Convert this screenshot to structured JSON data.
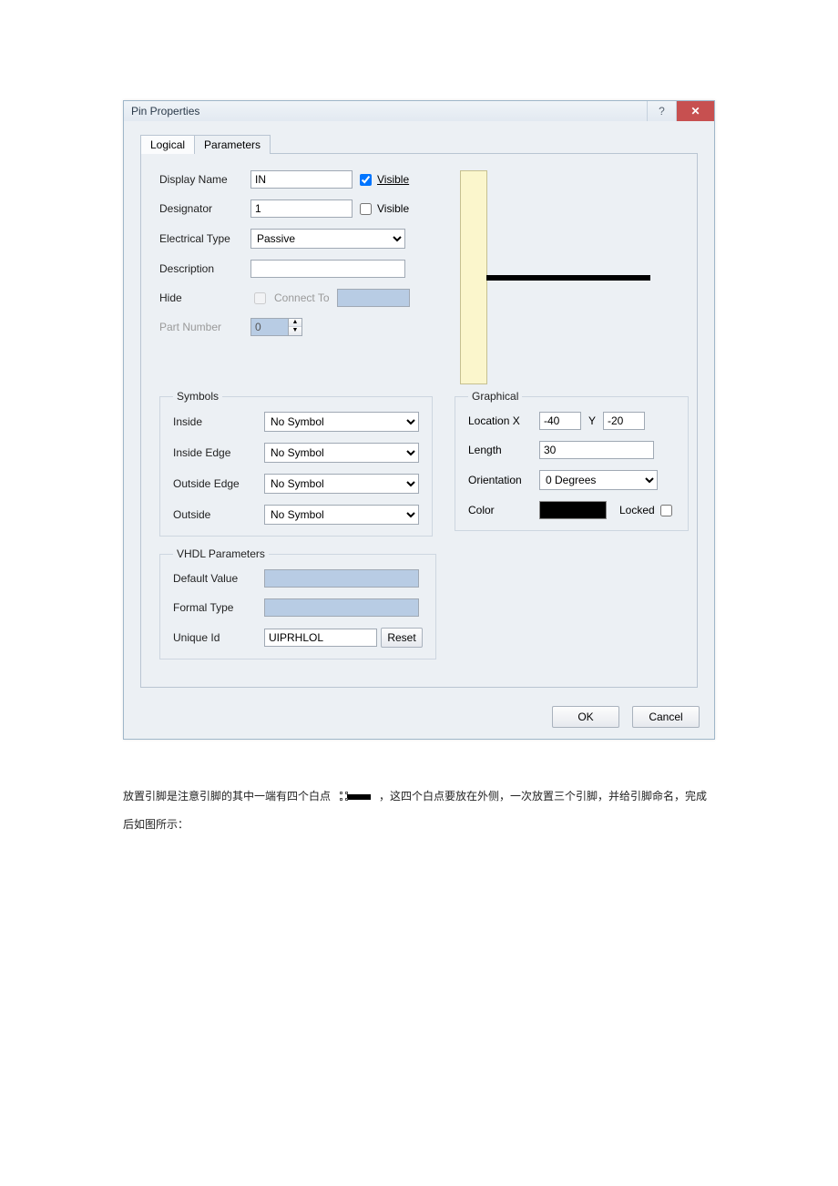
{
  "window": {
    "title": "Pin Properties"
  },
  "tabs": {
    "logical": "Logical",
    "parameters": "Parameters"
  },
  "fields": {
    "displayName": {
      "label": "Display Name",
      "value": "IN",
      "visibleLabel": "Visible",
      "visibleChecked": true
    },
    "designator": {
      "label": "Designator",
      "value": "1",
      "visibleLabel": "Visible",
      "visibleChecked": false
    },
    "electricalType": {
      "label": "Electrical Type",
      "value": "Passive"
    },
    "description": {
      "label": "Description",
      "value": ""
    },
    "hide": {
      "label": "Hide",
      "connectLabel": "Connect To",
      "checked": false
    },
    "partNumber": {
      "label": "Part Number",
      "value": "0"
    }
  },
  "symbols": {
    "legend": "Symbols",
    "inside": {
      "label": "Inside",
      "value": "No Symbol"
    },
    "insideEdge": {
      "label": "Inside Edge",
      "value": "No Symbol"
    },
    "outsideEdge": {
      "label": "Outside Edge",
      "value": "No Symbol"
    },
    "outside": {
      "label": "Outside",
      "value": "No Symbol"
    }
  },
  "vhdl": {
    "legend": "VHDL Parameters",
    "defaultValue": {
      "label": "Default Value",
      "value": ""
    },
    "formalType": {
      "label": "Formal Type",
      "value": ""
    },
    "uniqueId": {
      "label": "Unique Id",
      "value": "UIPRHLOL",
      "reset": "Reset"
    }
  },
  "graphical": {
    "legend": "Graphical",
    "locationX": {
      "label": "Location X",
      "value": "-40"
    },
    "locationY": {
      "label": "Y",
      "value": "-20"
    },
    "length": {
      "label": "Length",
      "value": "30"
    },
    "orientation": {
      "label": "Orientation",
      "value": "0 Degrees"
    },
    "color": {
      "label": "Color",
      "value": "#000000"
    },
    "locked": {
      "label": "Locked",
      "checked": false
    }
  },
  "buttons": {
    "ok": "OK",
    "cancel": "Cancel"
  },
  "docText": {
    "before": "放置引脚是注意引脚的其中一端有四个白点",
    "after": "，这四个白点要放在外侧，一次放置三个引脚，并给引脚命名，完成后如图所示："
  }
}
